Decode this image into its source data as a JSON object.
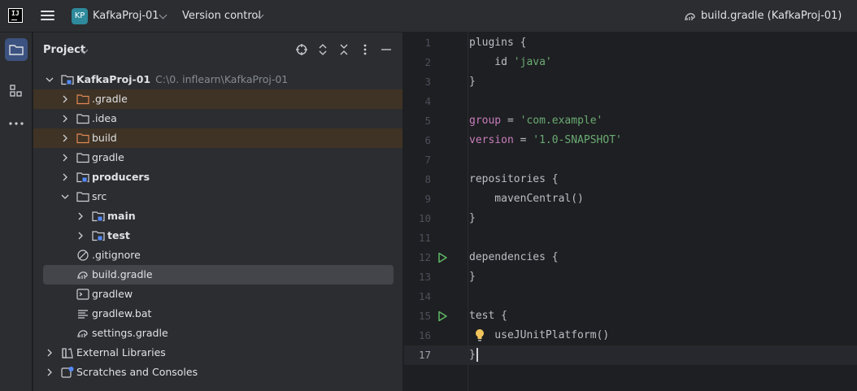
{
  "titlebar": {
    "logo_text": "IJ",
    "project_badge": "KP",
    "project_name": "KafkaProj-01",
    "vcs_label": "Version control",
    "file_title": "build.gradle (KafkaProj-01)"
  },
  "left_toolbar": {
    "items": [
      "folder-icon",
      "structure-icon",
      "more-icon"
    ]
  },
  "project_panel": {
    "title": "Project",
    "tree": [
      {
        "label": "KafkaProj-01",
        "hint": "C:\\0. inflearn\\KafkaProj-01",
        "bold": true,
        "expanded": true
      },
      {
        "label": ".gradle",
        "excluded": true
      },
      {
        "label": ".idea"
      },
      {
        "label": "build",
        "excluded": true
      },
      {
        "label": "gradle"
      },
      {
        "label": "producers",
        "bold": true
      },
      {
        "label": "src",
        "expanded": true
      },
      {
        "label": "main",
        "bold": true
      },
      {
        "label": "test",
        "bold": true
      },
      {
        "label": ".gitignore"
      },
      {
        "label": "build.gradle",
        "selected": true
      },
      {
        "label": "gradlew"
      },
      {
        "label": "gradlew.bat"
      },
      {
        "label": "settings.gradle"
      },
      {
        "label": "External Libraries"
      },
      {
        "label": "Scratches and Consoles"
      }
    ]
  },
  "editor": {
    "current_line": 17,
    "lines": [
      {
        "n": "1",
        "parts": [
          {
            "t": "plugins {",
            "c": ""
          }
        ]
      },
      {
        "n": "2",
        "parts": [
          {
            "t": "    id ",
            "c": ""
          },
          {
            "t": "'java'",
            "c": "str"
          }
        ]
      },
      {
        "n": "3",
        "parts": [
          {
            "t": "}",
            "c": ""
          }
        ]
      },
      {
        "n": "4",
        "parts": []
      },
      {
        "n": "5",
        "parts": [
          {
            "t": "group",
            "c": "kw"
          },
          {
            "t": " = ",
            "c": ""
          },
          {
            "t": "'com.example'",
            "c": "str"
          }
        ]
      },
      {
        "n": "6",
        "parts": [
          {
            "t": "version",
            "c": "kw"
          },
          {
            "t": " = ",
            "c": ""
          },
          {
            "t": "'1.0-SNAPSHOT'",
            "c": "str"
          }
        ]
      },
      {
        "n": "7",
        "parts": []
      },
      {
        "n": "8",
        "parts": [
          {
            "t": "repositories {",
            "c": ""
          }
        ]
      },
      {
        "n": "9",
        "parts": [
          {
            "t": "    mavenCentral()",
            "c": ""
          }
        ]
      },
      {
        "n": "10",
        "parts": [
          {
            "t": "}",
            "c": ""
          }
        ]
      },
      {
        "n": "11",
        "parts": []
      },
      {
        "n": "12",
        "parts": [
          {
            "t": "dependencies {",
            "c": ""
          }
        ],
        "run": true
      },
      {
        "n": "13",
        "parts": [
          {
            "t": "}",
            "c": ""
          }
        ]
      },
      {
        "n": "14",
        "parts": []
      },
      {
        "n": "15",
        "parts": [
          {
            "t": "test {",
            "c": ""
          }
        ],
        "run": true
      },
      {
        "n": "16",
        "parts": [
          {
            "t": "    useJUnitPlatform()",
            "c": ""
          }
        ],
        "bulb": true
      },
      {
        "n": "17",
        "parts": [
          {
            "t": "}",
            "c": ""
          }
        ],
        "caret": true
      }
    ]
  },
  "colors": {
    "accent": "#3c5280",
    "keyword": "#c77dbb",
    "string": "#6aab73",
    "excluded_bg": "#3f3325",
    "run_icon": "#5fb865"
  }
}
